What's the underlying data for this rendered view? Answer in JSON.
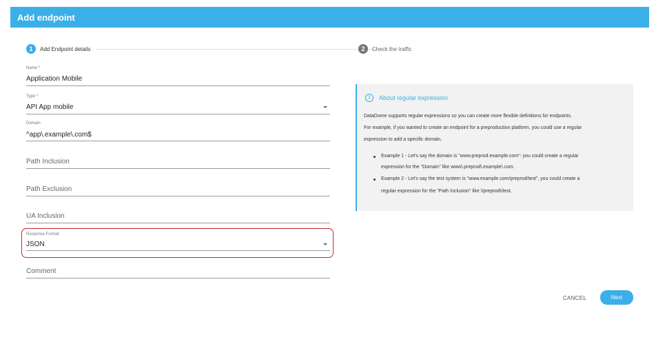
{
  "header": {
    "title": "Add endpoint"
  },
  "stepper": {
    "steps": [
      {
        "number": "1",
        "label": "Add Endpoint details"
      },
      {
        "number": "2",
        "label": "Check the traffic"
      }
    ]
  },
  "form": {
    "name": {
      "label": "Name *",
      "value": "Application Mobile"
    },
    "type": {
      "label": "Type *",
      "value": "API App mobile"
    },
    "domain": {
      "label": "Domain",
      "value": "^app\\.example\\.com$"
    },
    "path_inclusion": {
      "placeholder": "Path Inclusion"
    },
    "path_exclusion": {
      "placeholder": "Path Exclusion"
    },
    "ua_inclusion": {
      "placeholder": "UA Inclusion"
    },
    "response_format": {
      "label": "Response Format",
      "value": "JSON"
    },
    "comment": {
      "placeholder": "Comment"
    }
  },
  "info": {
    "icon": "info-icon",
    "title": "About regular expression",
    "lines": [
      "DataDome supports regular expressions so you can create more flexible definitions for endpoints.",
      "For example, if you wanted to create an endpoint for a preproduction platform, you could use a regular",
      "expression to add a specific domain."
    ],
    "bullets": [
      [
        "Example 1 - Let's say the domain is \"www.preprod.example.com\": you could create a regular",
        "expression for the \"Domain\" like www\\.preprod\\.example\\.com."
      ],
      [
        "Example 2 - Let's say the test system is \"www.example.com/preprod/test\", you could create a",
        "regular expression for the \"Path Inclusion\" like \\/preprod\\/test."
      ]
    ]
  },
  "actions": {
    "cancel": "CANCEL",
    "next": "Next"
  },
  "colors": {
    "accent": "#3aafe8",
    "highlight": "#c62828"
  }
}
